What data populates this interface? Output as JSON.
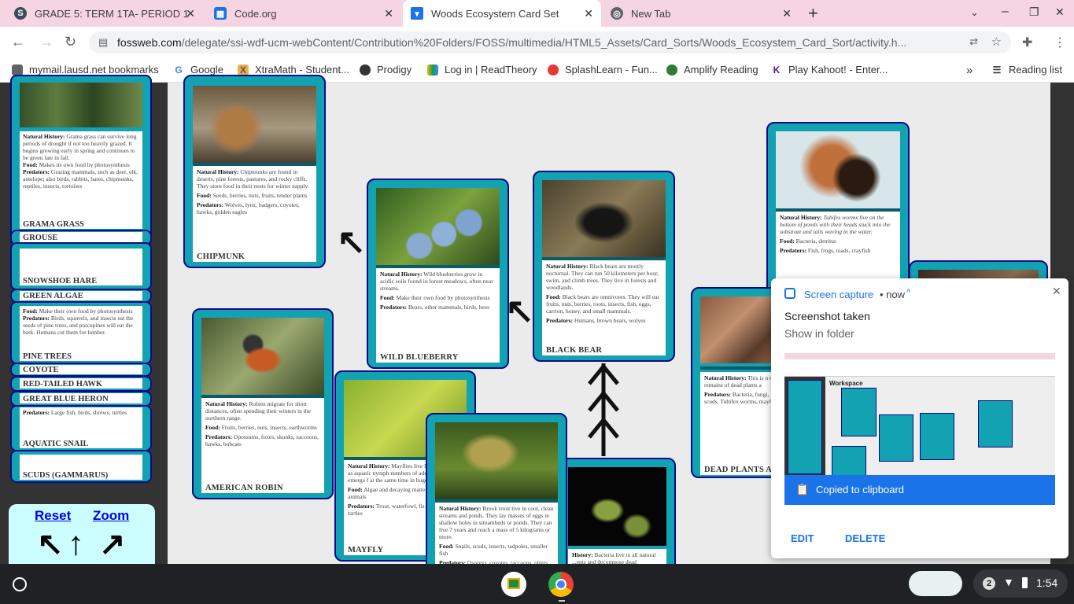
{
  "browser": {
    "tabs": [
      {
        "title": "GRADE 5: TERM 1TA- PERIOD 1",
        "icon": "schoology-icon",
        "color": "#3c4b5d"
      },
      {
        "title": "Code.org",
        "icon": "codeorg-icon",
        "color": "#1a73e8"
      },
      {
        "title": "Woods Ecosystem Card Set",
        "icon": "fossweb-icon",
        "color": "#1a73e8"
      },
      {
        "title": "New Tab",
        "icon": "chrome-icon",
        "color": "#5f6368"
      }
    ],
    "url_host": "fossweb.com",
    "url_path": "/delegate/ssi-wdf-ucm-webContent/Contribution%20Folders/FOSS/multimedia/HTML5_Assets/Card_Sorts/Woods_Ecosystem_Card_Sort/activity.h...",
    "bookmarks": [
      "mymail.lausd.net bookmarks",
      "Google",
      "XtraMath - Student...",
      "Prodigy",
      "Log in | ReadTheory",
      "SplashLearn - Fun...",
      "Amplify Reading",
      "Play Kahoot! - Enter..."
    ],
    "more_bookmarks": "»",
    "reading_list": "Reading list"
  },
  "sidebar_cards": [
    {
      "name": "GRAMA GRASS",
      "natural_history": "Grama grass can survive long periods of drought if not too heavily grazed. It begins growing early in spring and continues to be green late in fall.",
      "food": "Makes its own food by photosynthesis",
      "predators": "Grazing mammals, such as deer, elk, antelope; also birds, rabbits, hares, chipmunks, reptiles, insects, tortoises"
    },
    {
      "name": "GROUSE"
    },
    {
      "name": "SNOWSHOE HARE"
    },
    {
      "name": "GREEN ALGAE"
    },
    {
      "name": "PINE TREES",
      "food": "Make their own food by photosynthesis",
      "predators": "Birds, squirrels, and insects eat the seeds of pine trees, and porcupines will eat the bark. Humans cut them for lumber."
    },
    {
      "name": "COYOTE"
    },
    {
      "name": "RED-TAILED HAWK"
    },
    {
      "name": "GREAT BLUE HERON"
    },
    {
      "name": "AQUATIC SNAIL",
      "predators": "Large fish, birds, shrews, turtles"
    },
    {
      "name": "SCUDS (GAMMARUS)"
    }
  ],
  "labels": {
    "natural_history": "Natural History:",
    "food": "Food:",
    "predators": "Predators:",
    "history": "History:"
  },
  "cards": {
    "chipmunk": {
      "name": "CHIPMUNK",
      "natural_history": "Chipmunks are found in deserts, pine forests, pastures, and rocky cliffs. They store food in their nests for winter supply.",
      "food": "Seeds, berries, nuts, fruits, tender plants",
      "predators": "Wolves, lynx, badgers, coyotes, hawks, golden eagles"
    },
    "blueberry": {
      "name": "WILD BLUEBERRY",
      "natural_history": "Wild blueberries grow in acidic soils found in forest meadows, often near streams.",
      "food": "Make their own food by photosynthesis",
      "predators": "Bears, other mammals, birds, bees"
    },
    "bear": {
      "name": "BLACK BEAR",
      "natural_history": "Black bears are mostly nocturnal. They can run 50 kilometers per hour, swim, and climb trees. They live in forests and woodlands.",
      "food": "Black bears are omnivores. They will eat fruits, nuts, berries, roots, insects, fish, eggs, carrion, honey, and small mammals.",
      "predators": "Humans, brown bears, wolves"
    },
    "tubifex": {
      "natural_history": "Tubifex worms live on the bottom of ponds with their heads stuck into the substrate and tails waving in the water.",
      "food": "Bacteria, detritus",
      "predators": "Fish, frogs, toads, crayfish"
    },
    "robin": {
      "name": "AMERICAN ROBIN",
      "natural_history": "Robins migrate for short distances, often spending their winters in the northern range.",
      "food": "Fruits, berries, nuts, insects, earthworms",
      "predators": "Opossums, foxes, skunks, raccoons, hawks, bobcats"
    },
    "mayfly": {
      "name": "MAYFLY",
      "natural_history": "Mayflies live life underwater as aquatic nymph numbers of adults may emerge f at the same time in huge mating",
      "food": "Algae and decaying matte plants and animals",
      "predators": "Trout, waterfowl, fis salamanders, turtles"
    },
    "trout": {
      "natural_history": "Brook trout live in cool, clean streams and ponds. They lay masses of eggs in shallow holes in streambeds or ponds. They can live 7 years and reach a mass of 5 kilograms or more.",
      "food": "Snails, scuds, insects, tadpoles, smaller fish",
      "predators": "Ospreys, coyotes, raccoons, otters,"
    },
    "bacteria": {
      "natural_history": "Bacteria live in all natural ...ents and decompose dead organisms."
    },
    "dead_plants": {
      "name": "DEAD PLANTS AN",
      "natural_history": "This is n the remains of dead plants a",
      "predators": "Bacteria, fungi, scuds, Tubifex worms, mayfl"
    }
  },
  "controls": {
    "reset": "Reset",
    "zoom": "Zoom",
    "arrows": [
      "↖",
      "↑",
      "↗"
    ]
  },
  "popup": {
    "app": "Screen capture",
    "time": "• now",
    "title": "Screenshot taken",
    "link": "Show in folder",
    "banner": "Copied to clipboard",
    "edit": "EDIT",
    "delete": "DELETE",
    "thumb_heading": "Workspace"
  },
  "shelf": {
    "notifications": "2",
    "time": "1:54"
  }
}
